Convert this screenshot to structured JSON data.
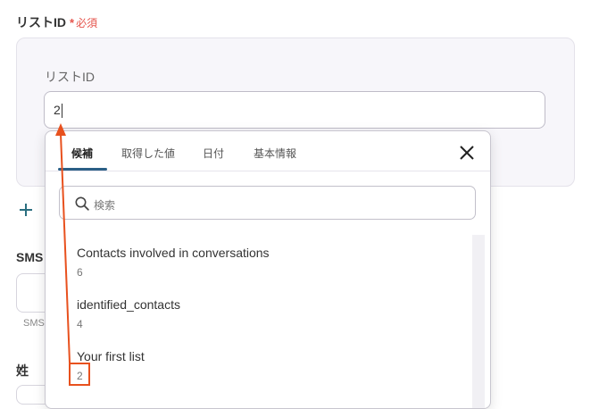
{
  "field": {
    "label": "リストID",
    "required_star": "*",
    "required_text": "必須",
    "inner_label": "リストID",
    "value": "2"
  },
  "background": {
    "sms_label": "SMS",
    "sms_small": "SMS",
    "last_name_label": "姓"
  },
  "popover": {
    "tabs": [
      {
        "label": "候補"
      },
      {
        "label": "取得した値"
      },
      {
        "label": "日付"
      },
      {
        "label": "基本情報"
      }
    ],
    "search_placeholder": "検索",
    "items": [
      {
        "title": "Contacts involved in conversations",
        "sub": "6"
      },
      {
        "title": "identified_contacts",
        "sub": "4"
      },
      {
        "title": "Your first list",
        "sub": "2"
      }
    ]
  },
  "colors": {
    "accent": "#2b5f86",
    "required": "#e5534b",
    "annotation": "#e8511e"
  }
}
